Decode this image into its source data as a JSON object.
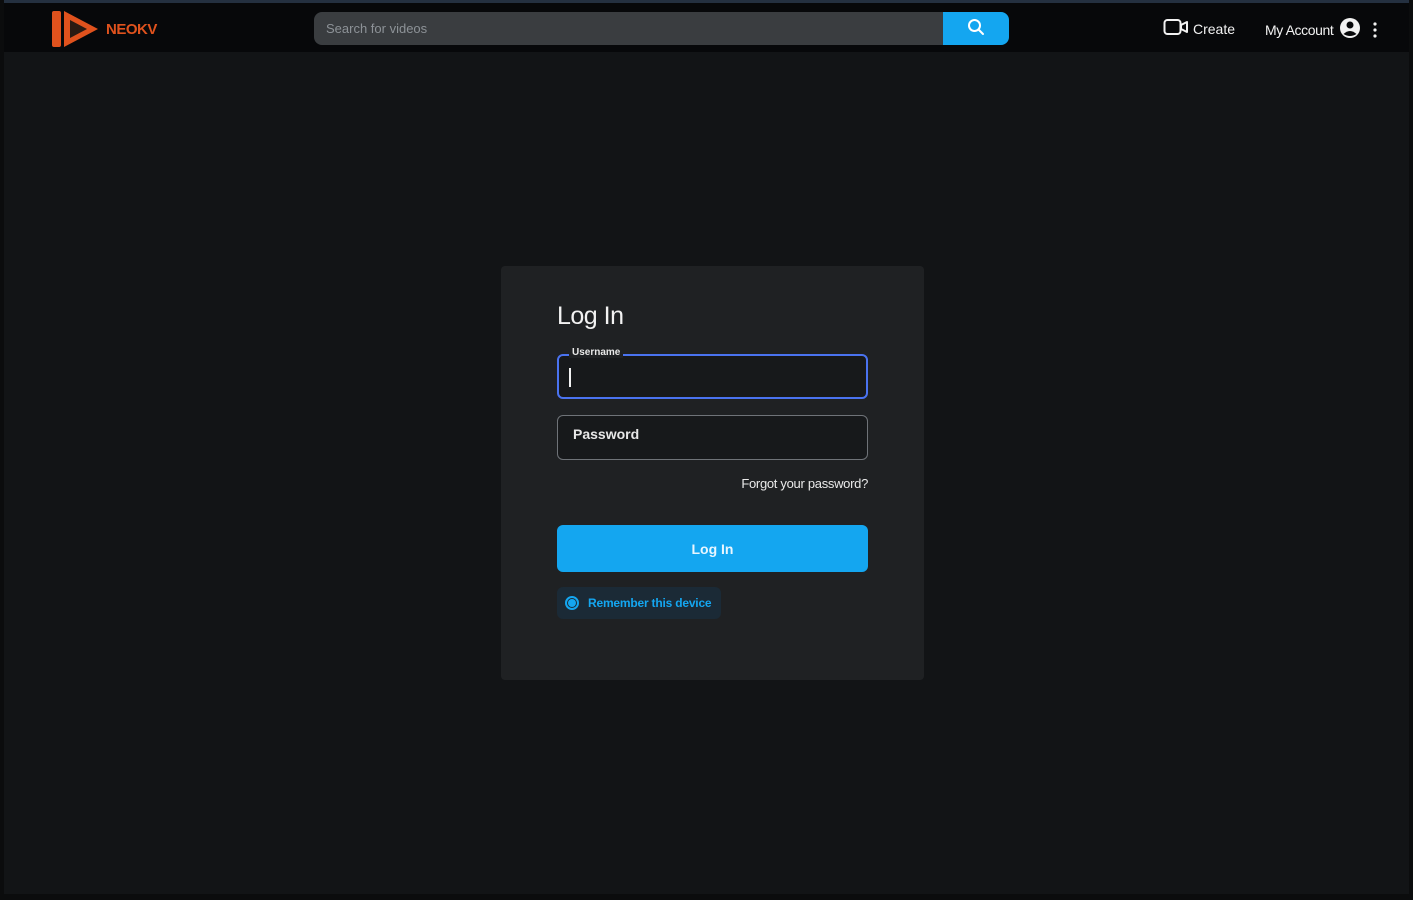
{
  "colors": {
    "accent": "#14a6f0",
    "brand": "#e0521d",
    "focus_border": "#4a73f0",
    "page_bg": "#121416",
    "card_bg": "#1f2123",
    "topbar_bg": "#07080a"
  },
  "header": {
    "logo_text": "NEOKV",
    "logo_icon": "play-logo-icon",
    "search": {
      "placeholder": "Search for videos",
      "value": "",
      "button_icon": "search-icon"
    },
    "create": {
      "icon": "video-camera-icon",
      "label": "Create"
    },
    "account": {
      "label": "My Account",
      "icon": "user-circle-icon",
      "menu_icon": "more-vertical-icon"
    }
  },
  "login": {
    "title": "Log In",
    "username": {
      "label": "Username",
      "value": "",
      "focused": true
    },
    "password": {
      "label": "Password",
      "value": ""
    },
    "forgot_link": "Forgot your password?",
    "submit_label": "Log In",
    "remember": {
      "label": "Remember this device",
      "checked": true
    }
  }
}
